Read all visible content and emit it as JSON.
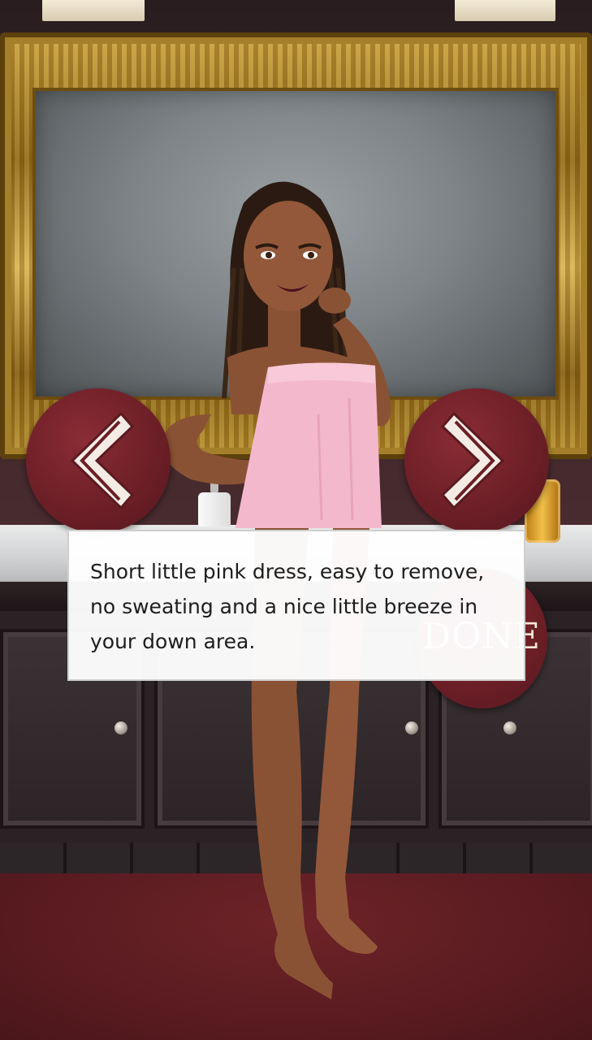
{
  "dialogue": {
    "text": "Short little pink dress, easy to remove, no sweating and a nice little breeze in your down area."
  },
  "navigation": {
    "prev_icon": "chevron-left-icon",
    "next_icon": "chevron-right-icon",
    "done_label": "DONE"
  },
  "colors": {
    "button": "#6b1e26",
    "dress": "#f4b8cc",
    "frame_gold": "#c9a040"
  }
}
